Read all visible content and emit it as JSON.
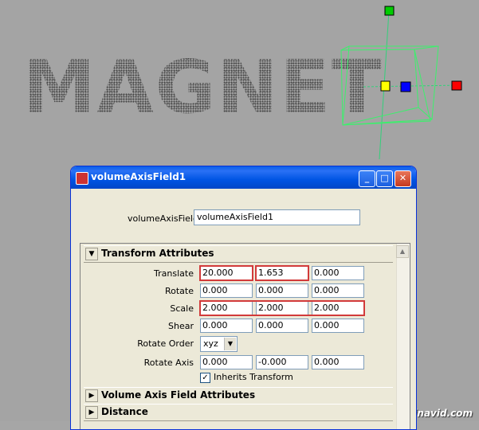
{
  "viewport": {
    "magnet_text": "MAGNET",
    "watermark": "Chinavid.com"
  },
  "window": {
    "title": "volumeAxisField1",
    "minimize_glyph": "_",
    "maximize_glyph": "□",
    "close_glyph": "✕",
    "name_label": "volumeAxisField:",
    "name_value": "volumeAxisField1"
  },
  "sections": {
    "transform": {
      "label": "Transform Attributes",
      "expanded_glyph": "▼"
    },
    "volume_axis": {
      "label": "Volume Axis Field Attributes",
      "collapsed_glyph": "▶"
    },
    "distance": {
      "label": "Distance",
      "collapsed_glyph": "▶"
    }
  },
  "attributes": {
    "translate": {
      "label": "Translate",
      "values": [
        "20.000",
        "1.653",
        "0.000"
      ]
    },
    "rotate": {
      "label": "Rotate",
      "values": [
        "0.000",
        "0.000",
        "0.000"
      ]
    },
    "scale": {
      "label": "Scale",
      "values": [
        "2.000",
        "2.000",
        "2.000"
      ]
    },
    "shear": {
      "label": "Shear",
      "values": [
        "0.000",
        "0.000",
        "0.000"
      ]
    },
    "rotate_order": {
      "label": "Rotate Order",
      "value": "xyz",
      "dropdown_glyph": "▼"
    },
    "rotate_axis": {
      "label": "Rotate Axis",
      "values": [
        "0.000",
        "-0.000",
        "0.000"
      ]
    },
    "inherits_transform": {
      "label": "Inherits Transform",
      "checked_glyph": "✓"
    }
  },
  "colors": {
    "highlight": "#d23a3a",
    "gizmo_box": "#3cf06c",
    "axis_y": "#00cc00",
    "axis_x": "#ff0000",
    "center_blue": "#0000ff",
    "center_yellow": "#ffff00"
  },
  "scroll_up_glyph": "▲"
}
